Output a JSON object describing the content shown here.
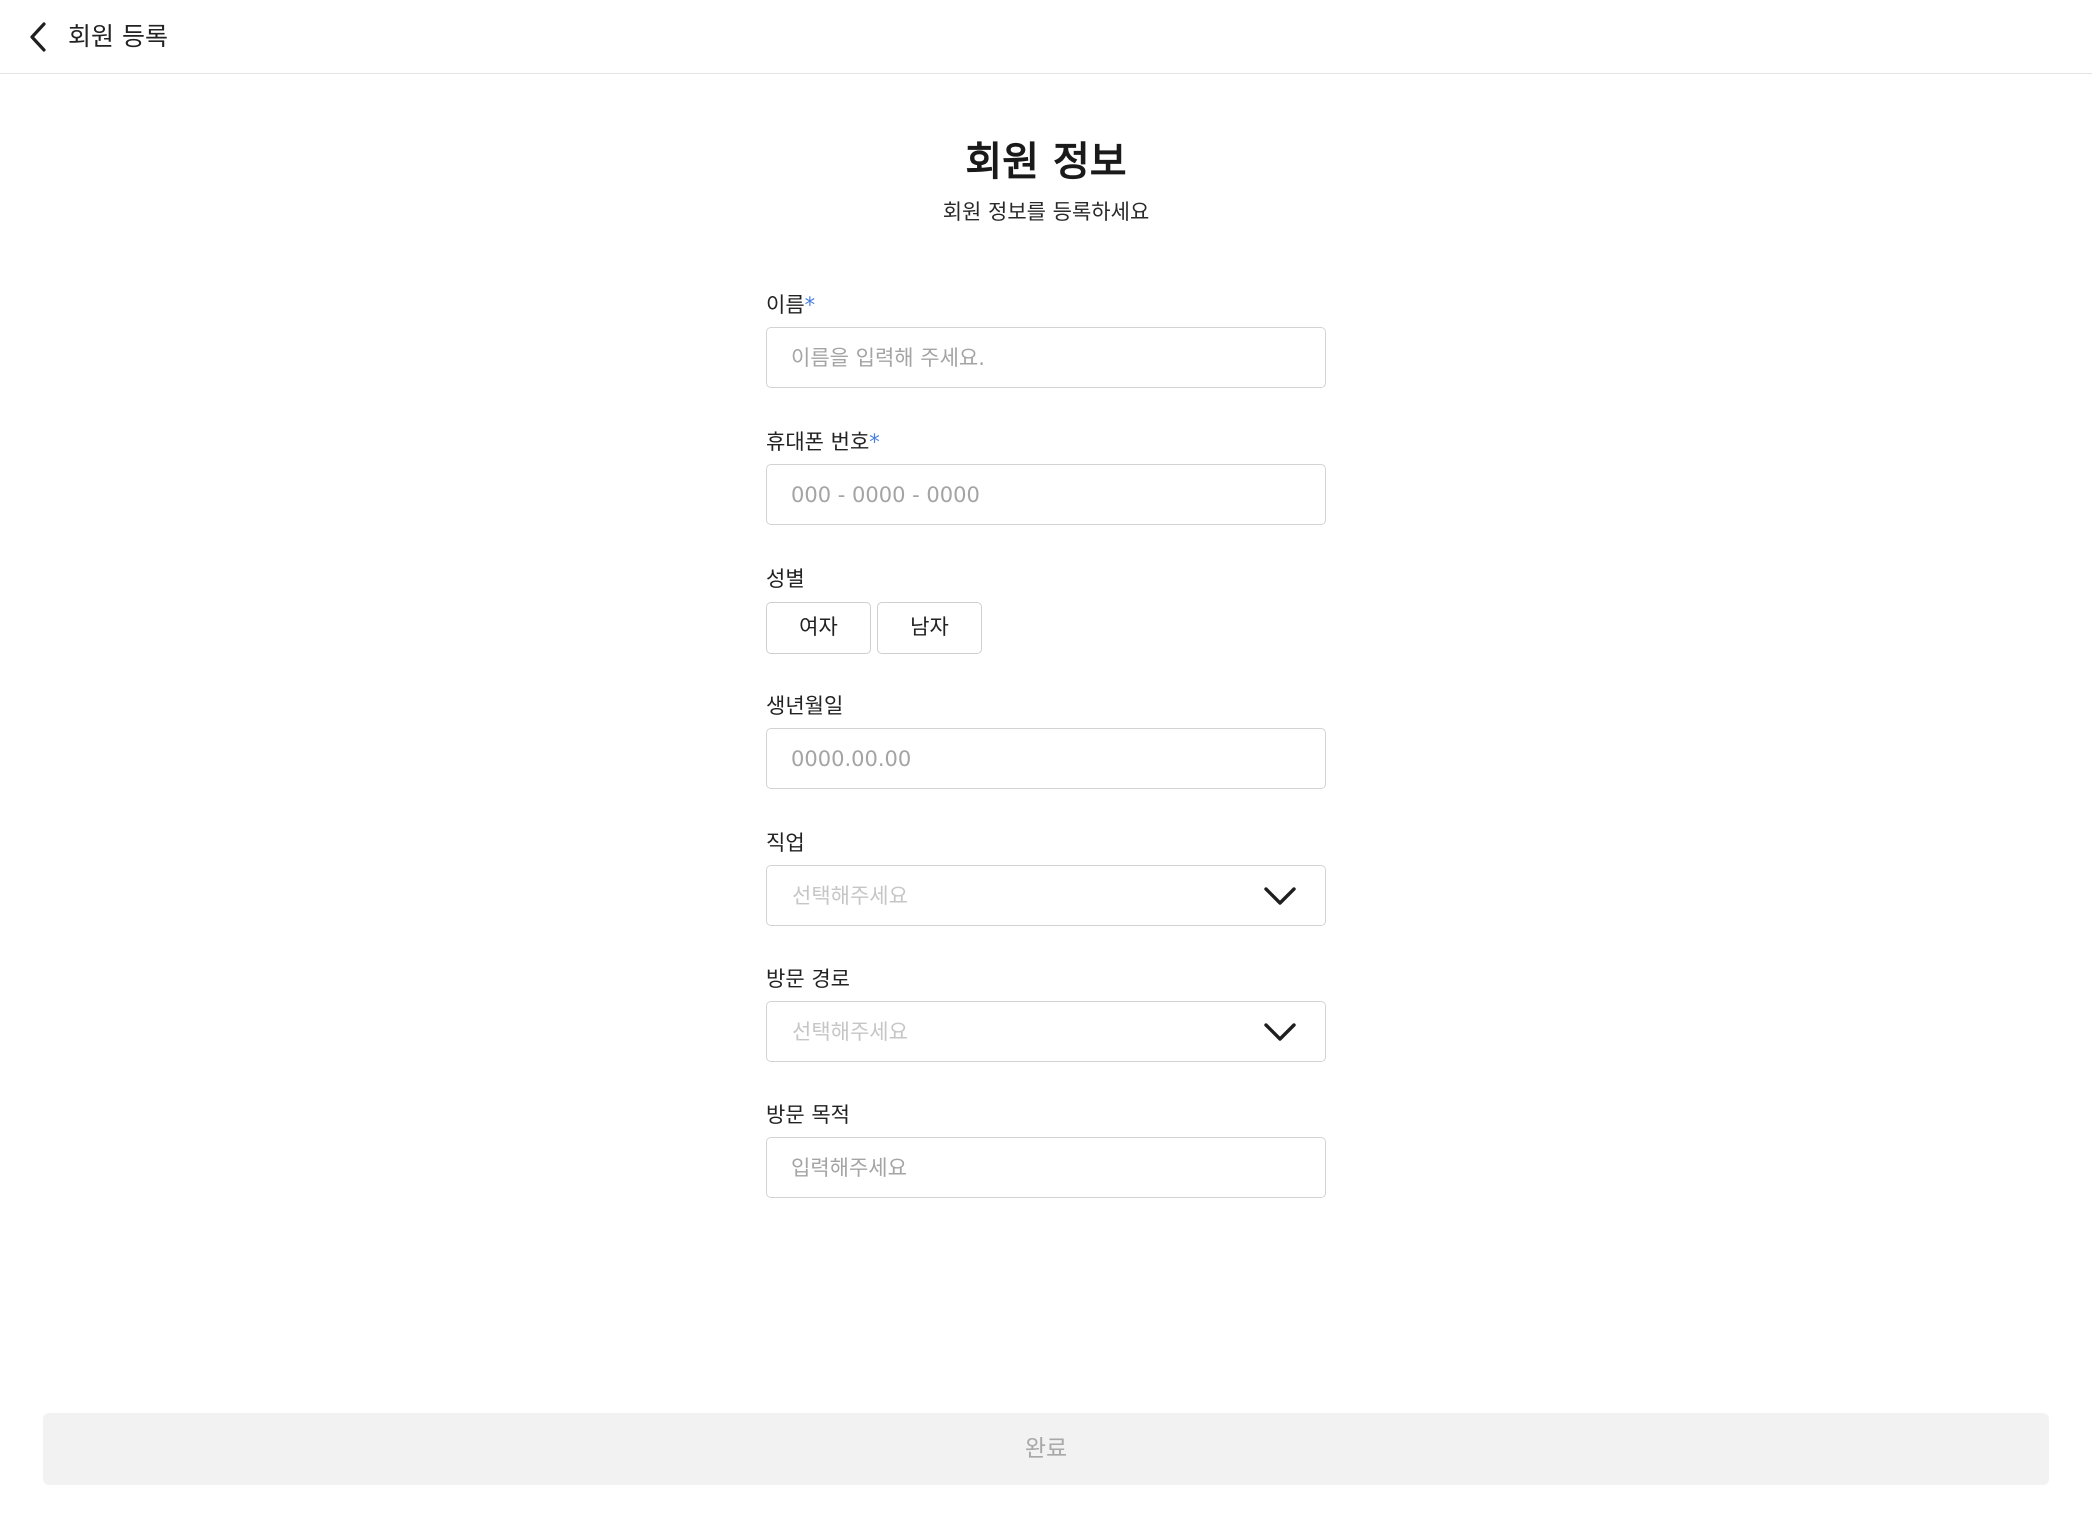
{
  "header": {
    "back_icon": "chevron-left-icon",
    "title": "회원 등록"
  },
  "form": {
    "title": "회원 정보",
    "subtitle": "회원 정보를 등록하세요",
    "required_mark": "*",
    "name": {
      "label": "이름",
      "required": true,
      "placeholder": "이름을 입력해 주세요."
    },
    "phone": {
      "label": "휴대폰 번호",
      "required": true,
      "placeholder": "000 - 0000 - 0000"
    },
    "gender": {
      "label": "성별",
      "options": [
        "여자",
        "남자"
      ]
    },
    "birthdate": {
      "label": "생년월일",
      "placeholder": "0000.00.00"
    },
    "job": {
      "label": "직업",
      "selected": "선택해주세요",
      "icon": "chevron-down-icon"
    },
    "visit_route": {
      "label": "방문 경로",
      "selected": "선택해주세요",
      "icon": "chevron-down-icon"
    },
    "visit_purpose": {
      "label": "방문 목적",
      "placeholder": "입력해주세요"
    }
  },
  "footer": {
    "submit_label": "완료"
  },
  "colors": {
    "required_accent": "#4a7fe0",
    "disabled_button_bg": "#f2f2f2",
    "disabled_button_text": "#a8a8a8",
    "border": "#d3d3d3"
  }
}
